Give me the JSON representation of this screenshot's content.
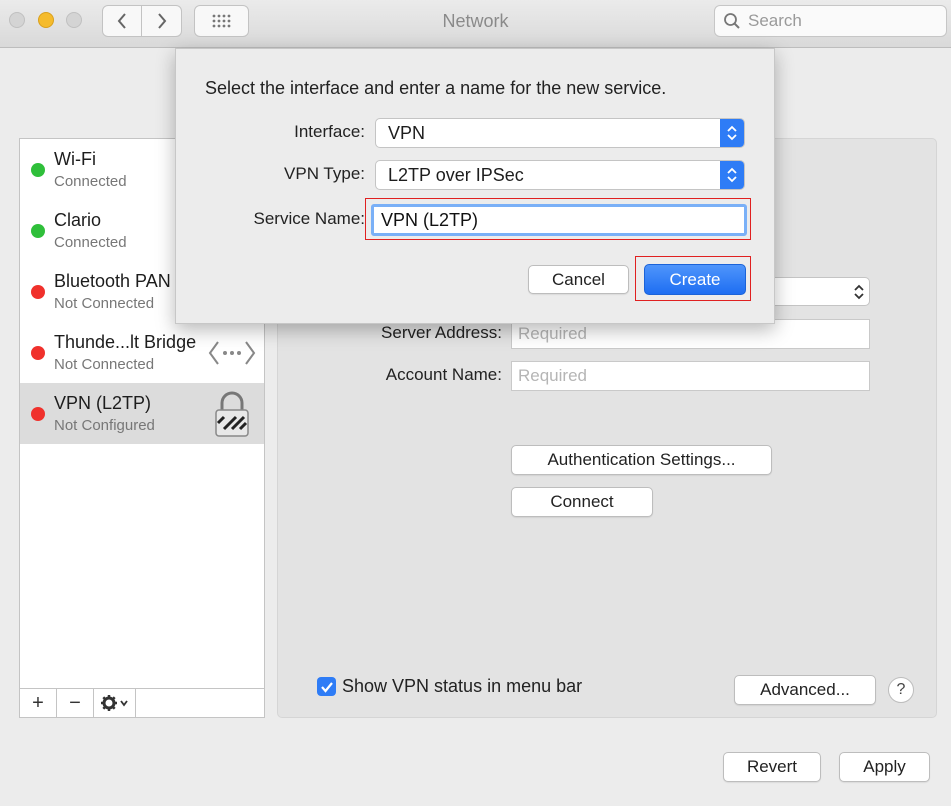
{
  "window": {
    "title": "Network"
  },
  "search": {
    "placeholder": "Search"
  },
  "services": [
    {
      "name": "Wi-Fi",
      "status": "Connected",
      "color": "#2fbf3a"
    },
    {
      "name": "Clario",
      "status": "Connected",
      "color": "#2fbf3a"
    },
    {
      "name": "Bluetooth PAN",
      "status": "Not Connected",
      "color": "#f0312c"
    },
    {
      "name": "Thunde...lt Bridge",
      "status": "Not Connected",
      "color": "#f0312c"
    },
    {
      "name": "VPN (L2TP)",
      "status": "Not Configured",
      "color": "#f0312c",
      "selected": true
    }
  ],
  "sidebar_toolbar": {
    "add": "+",
    "remove": "−"
  },
  "main": {
    "server_address_label": "Server Address:",
    "server_address_placeholder": "Required",
    "account_name_label": "Account Name:",
    "account_name_placeholder": "Required",
    "auth_button": "Authentication Settings...",
    "connect_button": "Connect",
    "show_vpn_status": "Show VPN status in menu bar",
    "show_vpn_checked": true,
    "advanced_button": "Advanced...",
    "help": "?"
  },
  "footer": {
    "revert": "Revert",
    "apply": "Apply"
  },
  "sheet": {
    "prompt": "Select the interface and enter a name for the new service.",
    "interface_label": "Interface:",
    "interface_value": "VPN",
    "vpn_type_label": "VPN Type:",
    "vpn_type_value": "L2TP over IPSec",
    "service_name_label": "Service Name:",
    "service_name_value": "VPN (L2TP)",
    "cancel": "Cancel",
    "create": "Create"
  },
  "colors": {
    "accent": "#2e7cf6",
    "highlight": "#e02020"
  }
}
